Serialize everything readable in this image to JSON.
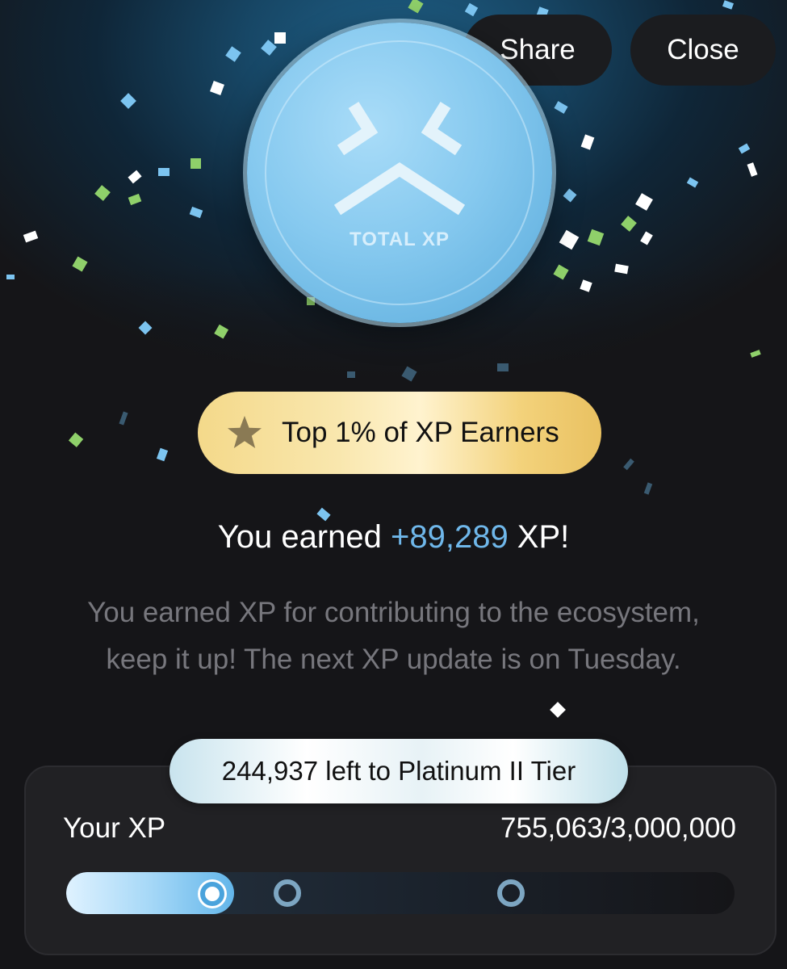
{
  "header": {
    "share_label": "Share",
    "close_label": "Close"
  },
  "coin": {
    "label": "TOTAL XP",
    "icon": "xp-logo-icon"
  },
  "badge": {
    "icon": "star-icon",
    "text": "Top 1% of XP Earners"
  },
  "earned": {
    "prefix": "You earned ",
    "amount": "+89,289",
    "suffix": " XP!"
  },
  "description": {
    "line1": "You earned XP for contributing to the ecosystem,",
    "line2": "keep it up! The next XP update is on Tuesday."
  },
  "progress": {
    "tier_text": "244,937 left to Platinum II Tier",
    "label": "Your XP",
    "count": "755,063/3,000,000",
    "current_xp": 755063,
    "max_xp": 3000000
  },
  "colors": {
    "accent": "#6fb7ea",
    "gold": "#f4d98a",
    "background": "#151518"
  }
}
